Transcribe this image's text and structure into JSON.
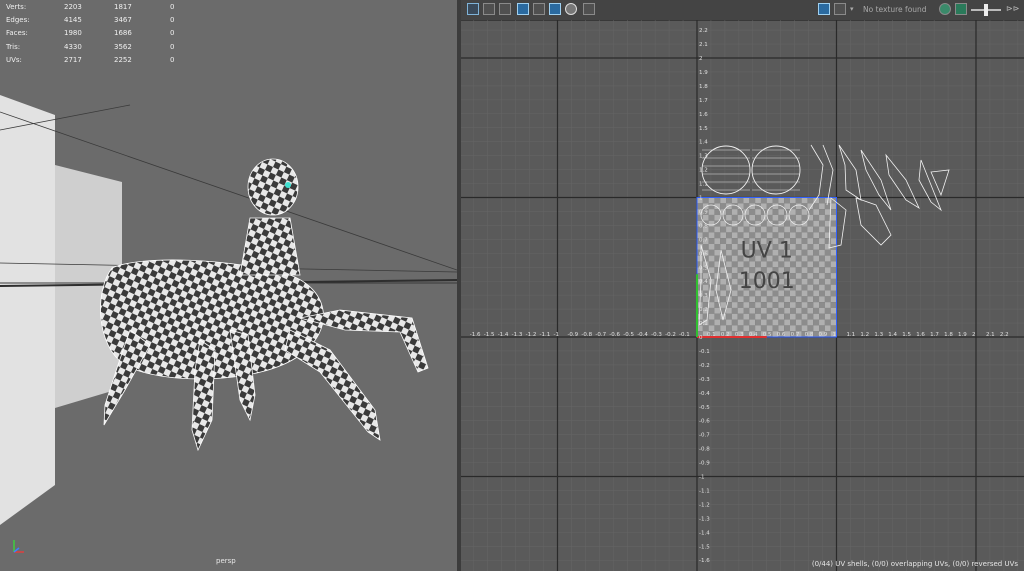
{
  "viewport": {
    "camera_label": "persp",
    "hud": {
      "rows": [
        {
          "label": "Verts:",
          "v1": "2203",
          "v2": "1817",
          "v3": "0"
        },
        {
          "label": "Edges:",
          "v1": "4145",
          "v2": "3467",
          "v3": "0"
        },
        {
          "label": "Faces:",
          "v1": "1980",
          "v2": "1686",
          "v3": "0"
        },
        {
          "label": "Tris:",
          "v1": "4330",
          "v2": "3562",
          "v3": "0"
        },
        {
          "label": "UVs:",
          "v1": "2717",
          "v2": "2252",
          "v3": "0"
        }
      ]
    }
  },
  "uv_editor": {
    "toolbar_icons": [
      "uv-shell-icon",
      "texture-tile-icon",
      "histogram-icon",
      "image-icon",
      "grid-icon",
      "display-grid-icon",
      "sun-icon",
      "snapshot-icon"
    ],
    "texture_placeholder": "No texture found",
    "udim_labels": [
      "1001",
      "UV 1"
    ],
    "status": "(0/44) UV shells, (0/0) overlapping UVs, (0/0) reversed UVs",
    "v_ticks": [
      "2.2",
      "2.1",
      "2",
      "1.9",
      "1.8",
      "1.7",
      "1.6",
      "1.5",
      "1.4",
      "1.3",
      "1.2",
      "1.1",
      "1",
      "0.9",
      "0.8",
      "0.7",
      "0.6",
      "0.5",
      "0.4",
      "0.3",
      "0.2",
      "0.1",
      "0",
      "-0.1",
      "-0.2",
      "-0.3",
      "-0.4",
      "-0.5",
      "-0.6",
      "-0.7",
      "-0.8",
      "-0.9",
      "-1",
      "-1.1",
      "-1.2",
      "-1.3",
      "-1.4",
      "-1.5",
      "-1.6",
      "-1.7",
      "-1.8"
    ],
    "u_ticks": [
      "-1.7",
      "-1.6",
      "-1.5",
      "-1.4",
      "-1.3",
      "-1.2",
      "-1.1",
      "-1",
      "-0.9",
      "-0.8",
      "-0.7",
      "-0.6",
      "-0.5",
      "-0.4",
      "-0.3",
      "-0.2",
      "-0.1",
      "0",
      "0.1",
      "0.2",
      "0.3",
      "0.4",
      "0.5",
      "0.6",
      "0.7",
      "0.8",
      "0.9",
      "1",
      "1.1",
      "1.2",
      "1.3",
      "1.4",
      "1.5",
      "1.6",
      "1.7",
      "1.8",
      "1.9",
      "2",
      "2.1",
      "2.2"
    ]
  }
}
